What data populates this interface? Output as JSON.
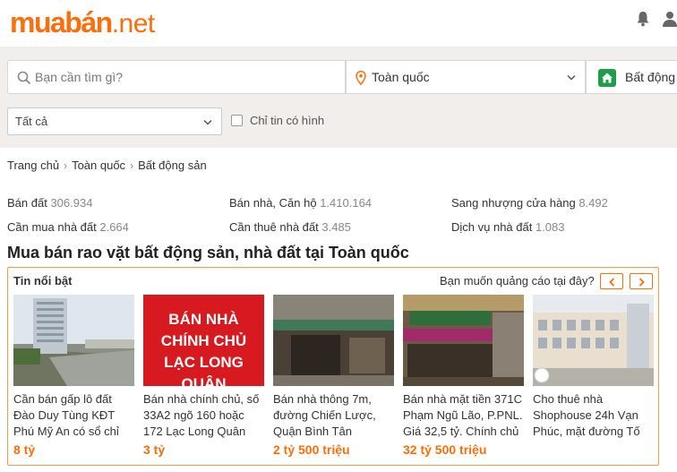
{
  "logo": {
    "brand": "muabán",
    "tld": ".net"
  },
  "topbar": {
    "icons": [
      "bell-icon",
      "user-icon"
    ]
  },
  "search": {
    "placeholder": "Bạn cần tìm gì?",
    "location": "Toàn quốc",
    "category": "Bất động"
  },
  "filter": {
    "select_value": "Tất cả",
    "checkbox_label": "Chỉ tin có hình"
  },
  "breadcrumb": [
    "Trang chủ",
    "Toàn quốc",
    "Bất động sản"
  ],
  "stats": [
    [
      {
        "label": "Bán đất",
        "count": "306.934"
      },
      {
        "label": "Bán nhà, Căn hộ",
        "count": "1.410.164"
      },
      {
        "label": "Sang nhượng cửa hàng",
        "count": "8.492"
      }
    ],
    [
      {
        "label": "Cần mua nhà đất",
        "count": "2.664"
      },
      {
        "label": "Cần thuê nhà đất",
        "count": "3.485"
      },
      {
        "label": "Dịch vụ nhà đất",
        "count": "1.083"
      }
    ]
  ],
  "section_title": "Mua bán rao vặt bất động sản, nhà đất tại Toàn quốc",
  "featured": {
    "title": "Tin nổi bật",
    "ad_question": "Bạn muốn quảng cáo tại đây?",
    "items": [
      {
        "title": "Cần bán gấp lô đất Đào Duy Tùng KĐT Phú Mỹ An có sổ chỉ",
        "price": "8 tỷ"
      },
      {
        "title": "Bán nhà chính chủ, số 33A2 ngõ 160 hoặc 172 Lạc Long Quân",
        "price": "3 tỷ",
        "image_text": "BÁN NHÀ CHÍNH CHỦ LẠC LONG QUÂN"
      },
      {
        "title": "Bán nhà thông 7m, đường Chiến Lược, Quận Bình Tân",
        "price": "2 tỷ 500 triệu"
      },
      {
        "title": "Bán nhà mặt tiền 371C Phạm Ngũ Lão, P.PNL. Giá 32,5 tỷ. Chính chủ",
        "price": "32 tỷ 500 triệu"
      },
      {
        "title": "Cho thuê nhà Shophouse 24h Vạn Phúc, mặt đường Tố",
        "price": ""
      }
    ]
  },
  "colors": {
    "accent": "#ff6e0c",
    "band": "#f1eeeb",
    "green": "#1e9e49"
  }
}
